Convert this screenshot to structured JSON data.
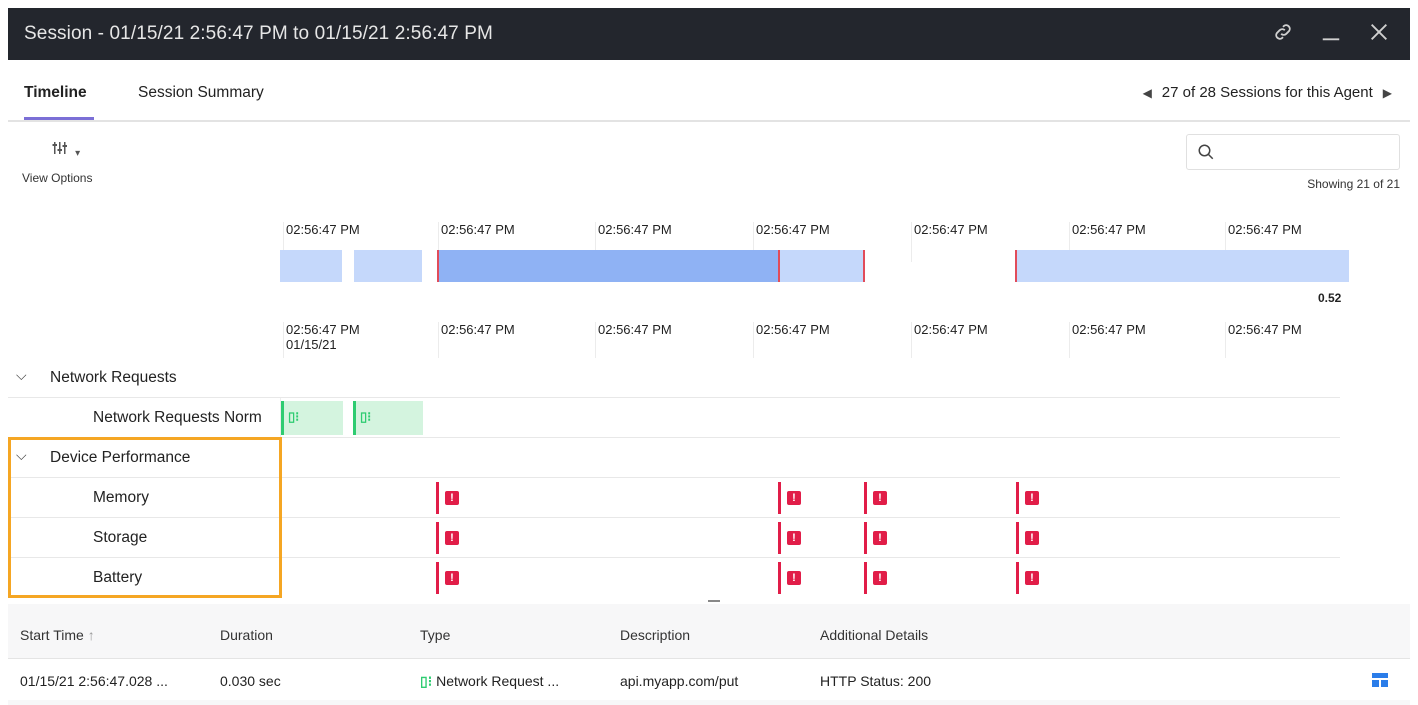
{
  "window": {
    "title": "Session - 01/15/21 2:56:47 PM to 01/15/21 2:56:47 PM",
    "controls": [
      "link-icon",
      "minimize-icon",
      "close-icon"
    ]
  },
  "tabs": [
    {
      "label": "Timeline",
      "active": true
    },
    {
      "label": "Session Summary",
      "active": false
    }
  ],
  "pager": {
    "text": "27 of 28 Sessions for this Agent"
  },
  "toolbar": {
    "view_options_label": "View Options",
    "search_placeholder": "",
    "showing": "Showing 21 of 21"
  },
  "overview": {
    "ticks": [
      "02:56:47 PM",
      "02:56:47 PM",
      "02:56:47 PM",
      "02:56:47 PM",
      "02:56:47 PM",
      "02:56:47 PM",
      "02:56:47 PM"
    ],
    "value_label": "0.52",
    "colors": {
      "light": "#c5d8fb",
      "dark": "#8fb2f4",
      "marker": "#e14c5a"
    }
  },
  "timeline": {
    "ticks": [
      "02:56:47 PM",
      "02:56:47 PM",
      "02:56:47 PM",
      "02:56:47 PM",
      "02:56:47 PM",
      "02:56:47 PM",
      "02:56:47 PM"
    ],
    "first_tick_date": "01/15/21"
  },
  "groups": {
    "network": {
      "label": "Network Requests",
      "rows": [
        {
          "label": "Network Requests Norm"
        }
      ]
    },
    "device": {
      "label": "Device Performance",
      "rows": [
        {
          "label": "Memory"
        },
        {
          "label": "Storage"
        },
        {
          "label": "Battery"
        }
      ]
    }
  },
  "table": {
    "headers": {
      "start_time": "Start Time",
      "duration": "Duration",
      "type": "Type",
      "description": "Description",
      "additional": "Additional Details"
    },
    "row": {
      "start_time": "01/15/21 2:56:47.028 ...",
      "duration": "0.030 sec",
      "type": "Network Request ...",
      "description": "api.myapp.com/put",
      "additional": "HTTP Status: 200"
    }
  },
  "colors": {
    "titlebar": "#23262d",
    "accent": "#7b6fd6",
    "highlight": "#f5a623",
    "network": "#2ecc71",
    "alert": "#e11d48"
  }
}
